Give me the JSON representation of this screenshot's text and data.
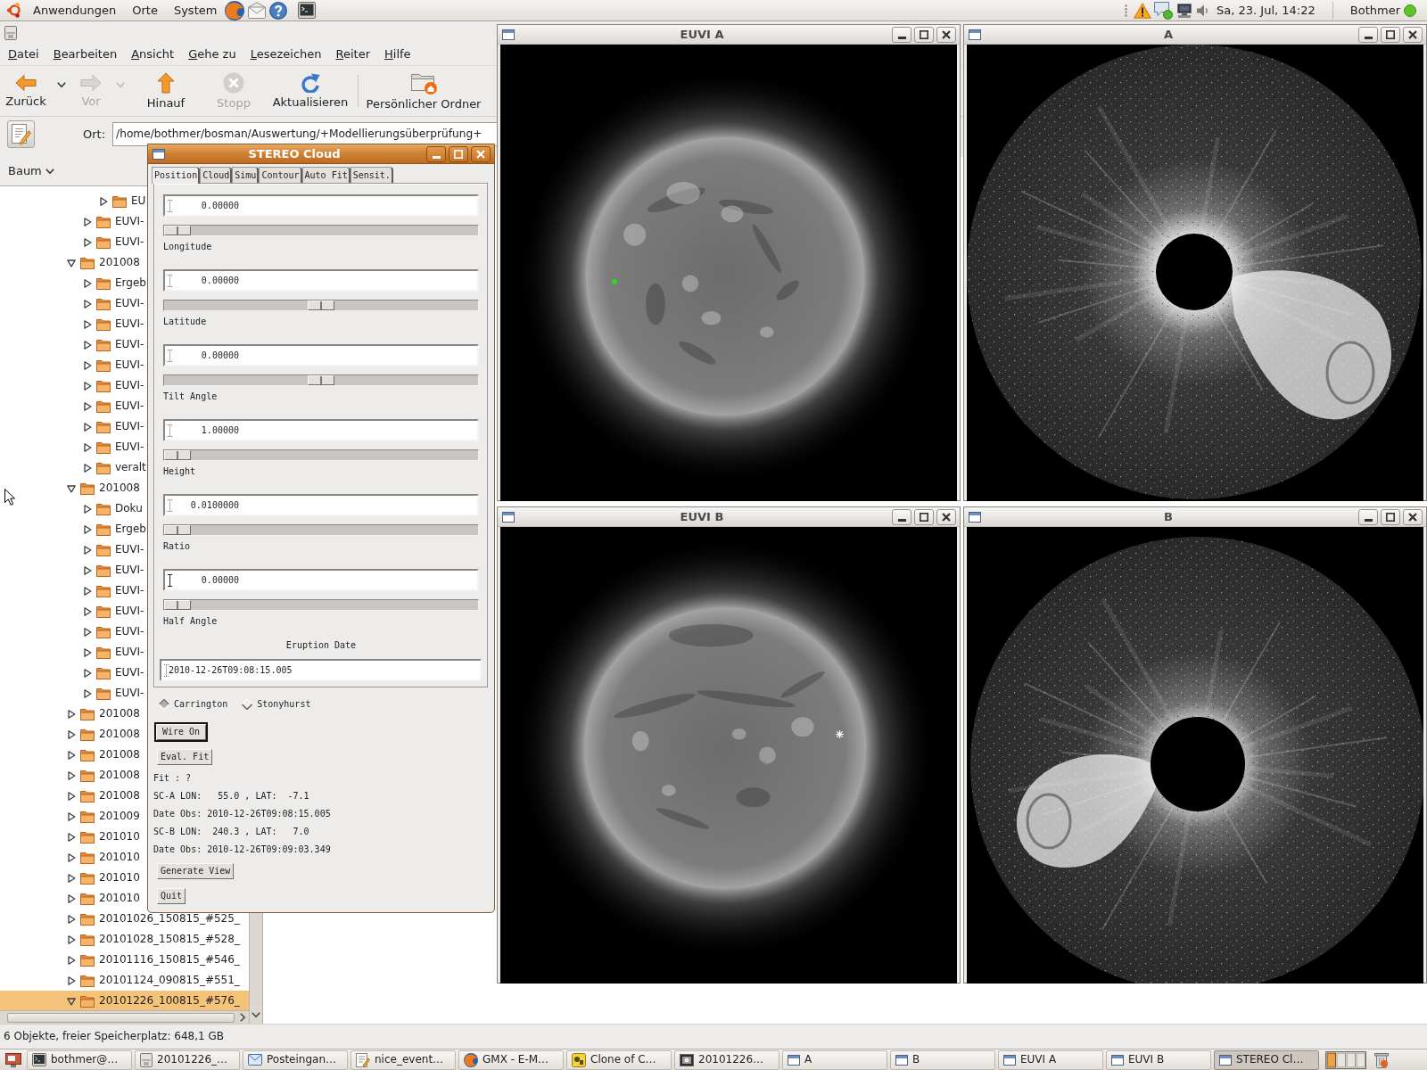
{
  "top_panel": {
    "menus": [
      "Anwendungen",
      "Orte",
      "System"
    ],
    "clock": "Sa, 23. Jul, 14:22",
    "user": "Bothmer"
  },
  "file_manager": {
    "menu": [
      "Datei",
      "Bearbeiten",
      "Ansicht",
      "Gehe zu",
      "Lesezeichen",
      "Reiter",
      "Hilfe"
    ],
    "toolbar": [
      {
        "kind": "back",
        "label": "Zurück",
        "disabled": false,
        "dropdown": true
      },
      {
        "kind": "forward",
        "label": "Vor",
        "disabled": true,
        "dropdown": true
      },
      {
        "kind": "up",
        "label": "Hinauf",
        "disabled": false,
        "dropdown": false
      },
      {
        "kind": "stop",
        "label": "Stopp",
        "disabled": true,
        "dropdown": false
      },
      {
        "kind": "reload",
        "label": "Aktualisieren",
        "disabled": false,
        "dropdown": false
      },
      {
        "kind": "separator"
      },
      {
        "kind": "home",
        "label": "Persönlicher Ordner",
        "disabled": false,
        "dropdown": false
      }
    ],
    "location": {
      "label": "Ort:",
      "value": "/home/bothmer/bosman/Auswertung/+Modellierungsüberprüfung+"
    },
    "side_pane": {
      "view": "Baum",
      "tree": [
        {
          "children": [
            {
              "children": [
                {
                  "label": "EU",
                  "expanded": false,
                  "selected": false
                }
              ]
            },
            {
              "label": "EUVI-",
              "expanded": false,
              "selected": false
            },
            {
              "label": "EUVI-",
              "expanded": false,
              "selected": false
            }
          ]
        },
        {
          "label": "201008",
          "expanded": true,
          "selected": false,
          "children": [
            {
              "label": "Ergeb",
              "expanded": false,
              "selected": false
            },
            {
              "label": "EUVI-",
              "expanded": false,
              "selected": false
            },
            {
              "label": "EUVI-",
              "expanded": false,
              "selected": false
            },
            {
              "label": "EUVI-",
              "expanded": false,
              "selected": false
            },
            {
              "label": "EUVI-",
              "expanded": false,
              "selected": false
            },
            {
              "label": "EUVI-",
              "expanded": false,
              "selected": false
            },
            {
              "label": "EUVI-",
              "expanded": false,
              "selected": false
            },
            {
              "label": "EUVI-",
              "expanded": false,
              "selected": false
            },
            {
              "label": "EUVI-",
              "expanded": false,
              "selected": false
            },
            {
              "label": "veralt",
              "expanded": false,
              "selected": false
            }
          ]
        },
        {
          "label": "201008",
          "expanded": true,
          "selected": false,
          "children": [
            {
              "label": "Doku",
              "expanded": false,
              "selected": false
            },
            {
              "label": "Ergeb",
              "expanded": false,
              "selected": false
            },
            {
              "label": "EUVI-",
              "expanded": false,
              "selected": false
            },
            {
              "label": "EUVI-",
              "expanded": false,
              "selected": false
            },
            {
              "label": "EUVI-",
              "expanded": false,
              "selected": false
            },
            {
              "label": "EUVI-",
              "expanded": false,
              "selected": false
            },
            {
              "label": "EUVI-",
              "expanded": false,
              "selected": false
            },
            {
              "label": "EUVI-",
              "expanded": false,
              "selected": false
            },
            {
              "label": "EUVI-",
              "expanded": false,
              "selected": false
            },
            {
              "label": "EUVI-",
              "expanded": false,
              "selected": false
            }
          ]
        },
        {
          "label": "201008",
          "expanded": false,
          "selected": false
        },
        {
          "label": "201008",
          "expanded": false,
          "selected": false
        },
        {
          "label": "201008",
          "expanded": false,
          "selected": false
        },
        {
          "label": "201008",
          "expanded": false,
          "selected": false
        },
        {
          "label": "201008",
          "expanded": false,
          "selected": false
        },
        {
          "label": "201009",
          "expanded": false,
          "selected": false
        },
        {
          "label": "201010",
          "expanded": false,
          "selected": false
        },
        {
          "label": "201010",
          "expanded": false,
          "selected": false
        },
        {
          "label": "201010",
          "expanded": false,
          "selected": false
        },
        {
          "label": "201010",
          "expanded": false,
          "selected": false
        },
        {
          "label": "20101026_150815_#525_",
          "expanded": false,
          "selected": false
        },
        {
          "label": "20101028_150815_#528_",
          "expanded": false,
          "selected": false
        },
        {
          "label": "20101116_150815_#546_",
          "expanded": false,
          "selected": false
        },
        {
          "label": "20101124_090815_#551_",
          "expanded": false,
          "selected": false
        },
        {
          "label": "20101226_100815_#576_",
          "expanded": true,
          "selected": true
        }
      ]
    },
    "status_bar": "6 Objekte, freier Speicherplatz: 648,1 GB"
  },
  "image_windows": [
    {
      "title": "EUVI A",
      "kind": "euv",
      "active": false
    },
    {
      "title": "A",
      "kind": "coronagraph",
      "active": false
    },
    {
      "title": "EUVI B",
      "kind": "euv",
      "active": false
    },
    {
      "title": "B",
      "kind": "coronagraph",
      "active": false
    }
  ],
  "cloud_window": {
    "title": "STEREO Cloud",
    "active": true,
    "tabs": [
      {
        "label": "Position",
        "selected": true
      },
      {
        "label": "Cloud",
        "selected": false
      },
      {
        "label": "Simu",
        "selected": false
      },
      {
        "label": "Contour",
        "selected": false
      },
      {
        "label": "Auto Fit",
        "selected": false
      },
      {
        "label": "Sensit.",
        "selected": false
      }
    ],
    "params": [
      {
        "field": {
          "value": "0.00000",
          "focused": false
        },
        "slider": {
          "level": 0,
          "title": "Longitude"
        }
      },
      {
        "field": {
          "value": "0.00000",
          "focused": false
        },
        "slider": {
          "level": 0.5,
          "title": "Latitude"
        }
      },
      {
        "field": {
          "value": "0.00000",
          "focused": false
        },
        "slider": {
          "level": 0.5,
          "title": "Tilt Angle"
        }
      },
      {
        "field": {
          "value": "1.00000",
          "focused": false
        },
        "slider": {
          "level": 0,
          "title": "Height"
        }
      },
      {
        "field": {
          "value": "0.0100000",
          "focused": false
        },
        "slider": {
          "level": 0,
          "title": "Ratio"
        }
      },
      {
        "field": {
          "value": "0.00000",
          "focused": true
        },
        "slider": {
          "level": 0,
          "title": "Half Angle"
        }
      }
    ],
    "date_label": "Eruption Date",
    "date_value": "2010-12-26T09:08:15.005",
    "coordinate_options": [
      {
        "label": "Carrington",
        "selected": true
      },
      {
        "label": "Stonyhurst",
        "selected": false
      }
    ],
    "controls": [
      {
        "kind": "button",
        "label": "Wire On",
        "focused": true
      },
      {
        "kind": "button",
        "label": "Eval. Fit",
        "focused": false
      },
      {
        "kind": "text",
        "text": "Fit : ?"
      },
      {
        "kind": "text",
        "text": "SC-A LON:   55.0 , LAT:  -7.1"
      },
      {
        "kind": "text",
        "text": "Date Obs: 2010-12-26T09:08:15.005"
      },
      {
        "kind": "text",
        "text": "SC-B LON:  240.3 , LAT:   7.0"
      },
      {
        "kind": "text",
        "text": "Date Obs: 2010-12-26T09:09:03.349"
      },
      {
        "kind": "button",
        "label": "Generate View",
        "focused": false
      },
      {
        "kind": "button",
        "label": "Quit",
        "focused": false
      }
    ]
  },
  "taskbar": {
    "tasks": [
      {
        "kind": "terminal",
        "label": "bothmer@…",
        "selected": false
      },
      {
        "kind": "files",
        "label": "20101226_…",
        "selected": false
      },
      {
        "kind": "mail",
        "label": "Posteingan…",
        "selected": false
      },
      {
        "kind": "editor",
        "label": "nice_event…",
        "selected": false
      },
      {
        "kind": "browser",
        "label": "GMX - E-M…",
        "selected": false
      },
      {
        "kind": "app",
        "label": "Clone of C…",
        "selected": false
      },
      {
        "kind": "image",
        "label": "20101226…",
        "selected": false
      },
      {
        "kind": "window",
        "label": "A",
        "selected": false
      },
      {
        "kind": "window",
        "label": "B",
        "selected": false
      },
      {
        "kind": "window",
        "label": "EUVI A",
        "selected": false
      },
      {
        "kind": "window",
        "label": "EUVI B",
        "selected": false
      },
      {
        "kind": "window",
        "label": "STEREO Cl…",
        "selected": true
      }
    ]
  }
}
